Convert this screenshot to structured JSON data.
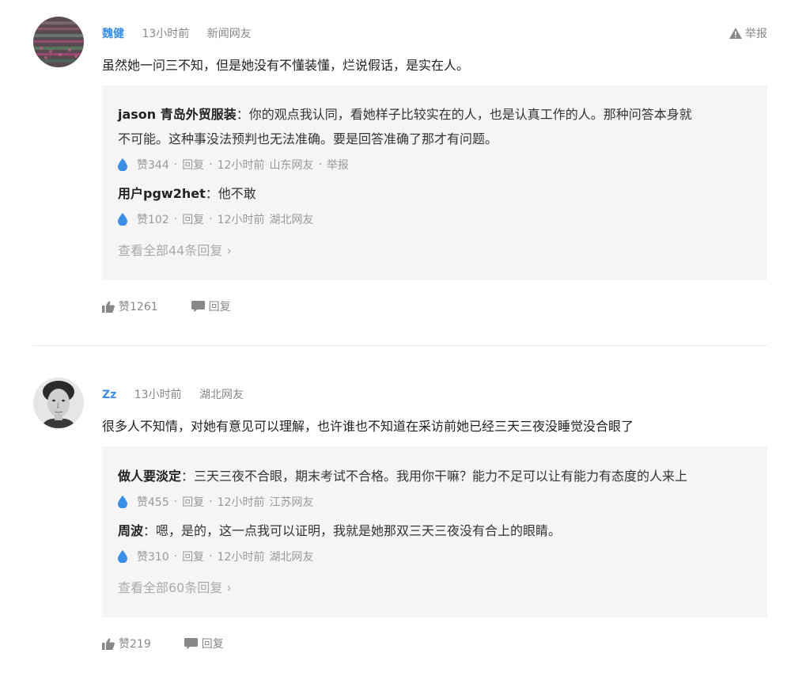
{
  "comments": [
    {
      "author": "魏健",
      "time": "13小时前",
      "location": "新闻网友",
      "report": "举报",
      "text": "虽然她一问三不知，但是她没有不懂装懂，烂说假话，是实在人。",
      "replies": [
        {
          "user": "jason 青岛外贸服装",
          "sep": "：",
          "text_line1": "你的观点我认同，看她样子比较实在的人，也是认真工作的人。那种问答本身就",
          "text_line2": "不可能。这种事没法预判也无法准确。要是回答准确了那才有问题。",
          "likes": "赞344",
          "reply_label": "回复",
          "time": "12小时前",
          "location": "山东网友",
          "report": "举报",
          "dot": "·"
        },
        {
          "user": "用户pgw2het",
          "sep": "：",
          "text_line1": "他不敢",
          "likes": "赞102",
          "reply_label": "回复",
          "time": "12小时前",
          "location": "湖北网友",
          "dot": "·"
        }
      ],
      "view_all": "查看全部44条回复 ›",
      "likes": "赞1261",
      "reply_label": "回复"
    },
    {
      "author": "Zz",
      "time": "13小时前",
      "location": "湖北网友",
      "text": "很多人不知情，对她有意见可以理解，也许谁也不知道在采访前她已经三天三夜没睡觉没合眼了",
      "replies": [
        {
          "user": "做人要淡定",
          "sep": "：",
          "text_line1": "三天三夜不合眼，期末考试不合格。我用你干嘛？能力不足可以让有能力有态度的人来上",
          "likes": "赞455",
          "reply_label": "回复",
          "time": "12小时前",
          "location": "江苏网友",
          "dot": "·"
        },
        {
          "user": "周波",
          "sep": "：",
          "text_line1": "嗯，是的，这一点我可以证明，我就是她那双三天三夜没有合上的眼睛。",
          "likes": "赞310",
          "reply_label": "回复",
          "time": "12小时前",
          "location": "湖北网友",
          "dot": "·"
        }
      ],
      "view_all": "查看全部60条回复 ›",
      "likes": "赞219",
      "reply_label": "回复"
    }
  ],
  "icons": {
    "warning": "warning-icon",
    "drop": "drop-icon",
    "thumb": "thumbs-up-icon",
    "bubble": "comment-bubble-icon"
  },
  "colors": {
    "author": "#3a8ee6",
    "drop": "#3a8ee6",
    "reply_bg": "#f5f5f5",
    "muted": "#888888"
  }
}
